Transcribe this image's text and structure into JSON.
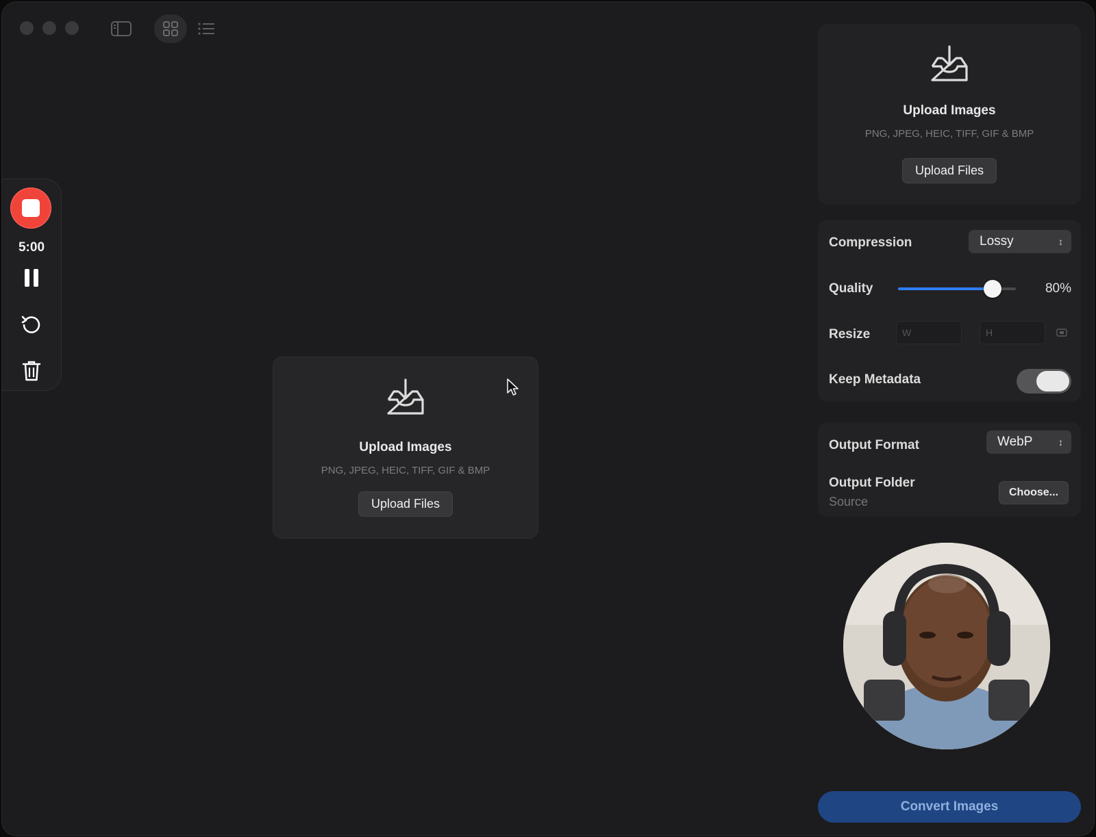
{
  "recorder": {
    "time": "5:00"
  },
  "main_upload": {
    "title": "Upload Images",
    "formats": "PNG, JPEG, HEIC, TIFF, GIF & BMP",
    "button": "Upload Files"
  },
  "sidebar": {
    "upload": {
      "title": "Upload Images",
      "formats": "PNG, JPEG, HEIC, TIFF, GIF & BMP",
      "button": "Upload Files"
    },
    "compression": {
      "label": "Compression",
      "value": "Lossy"
    },
    "quality": {
      "label": "Quality",
      "value": "80%",
      "fraction": 0.8
    },
    "resize": {
      "label": "Resize",
      "width_placeholder": "W",
      "height_placeholder": "H"
    },
    "keep_metadata": {
      "label": "Keep Metadata",
      "on": true
    },
    "output_format": {
      "label": "Output Format",
      "value": "WebP"
    },
    "output_folder": {
      "label": "Output Folder",
      "value": "Source",
      "button": "Choose..."
    },
    "convert": "Convert Images"
  },
  "colors": {
    "accent": "#2f7df6",
    "record": "#f0443a",
    "convert_bg": "#1f4583"
  }
}
